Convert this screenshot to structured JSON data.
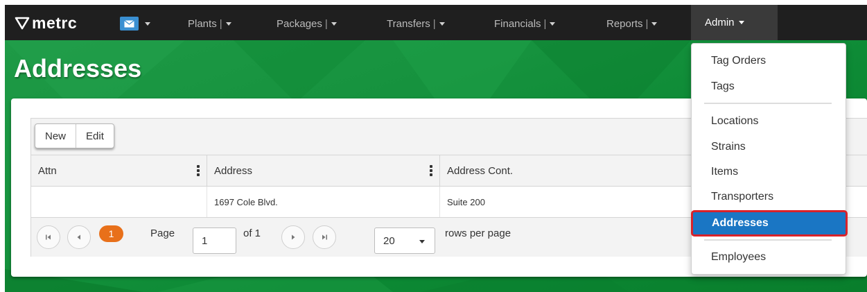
{
  "nav": {
    "logo_text": "metrc",
    "items": [
      {
        "label": "Plants"
      },
      {
        "label": "Packages"
      },
      {
        "label": "Transfers"
      },
      {
        "label": "Financials"
      },
      {
        "label": "Reports"
      }
    ],
    "admin_label": "Admin"
  },
  "page": {
    "title": "Addresses"
  },
  "toolbar": {
    "new_label": "New",
    "edit_label": "Edit"
  },
  "table": {
    "columns": [
      "Attn",
      "Address",
      "Address Cont."
    ],
    "rows": [
      {
        "attn": "",
        "address": "1697 Cole Blvd.",
        "address_cont": "Suite 200"
      }
    ]
  },
  "pager": {
    "current_page": "1",
    "page_label": "Page",
    "page_input_value": "1",
    "of_text": "of 1",
    "rows_per_page_value": "20",
    "rows_per_page_label": "rows per page"
  },
  "admin_menu": {
    "group1": [
      "Tag Orders",
      "Tags"
    ],
    "group2": [
      "Locations",
      "Strains",
      "Items",
      "Transporters"
    ],
    "active": "Addresses",
    "group3": [
      "Employees"
    ]
  },
  "colors": {
    "navbar": "#1f1f1f",
    "brand_green": "#16923e",
    "accent_blue": "#1a76c4",
    "highlight_red": "#d9222a",
    "pager_orange": "#e8701a"
  }
}
